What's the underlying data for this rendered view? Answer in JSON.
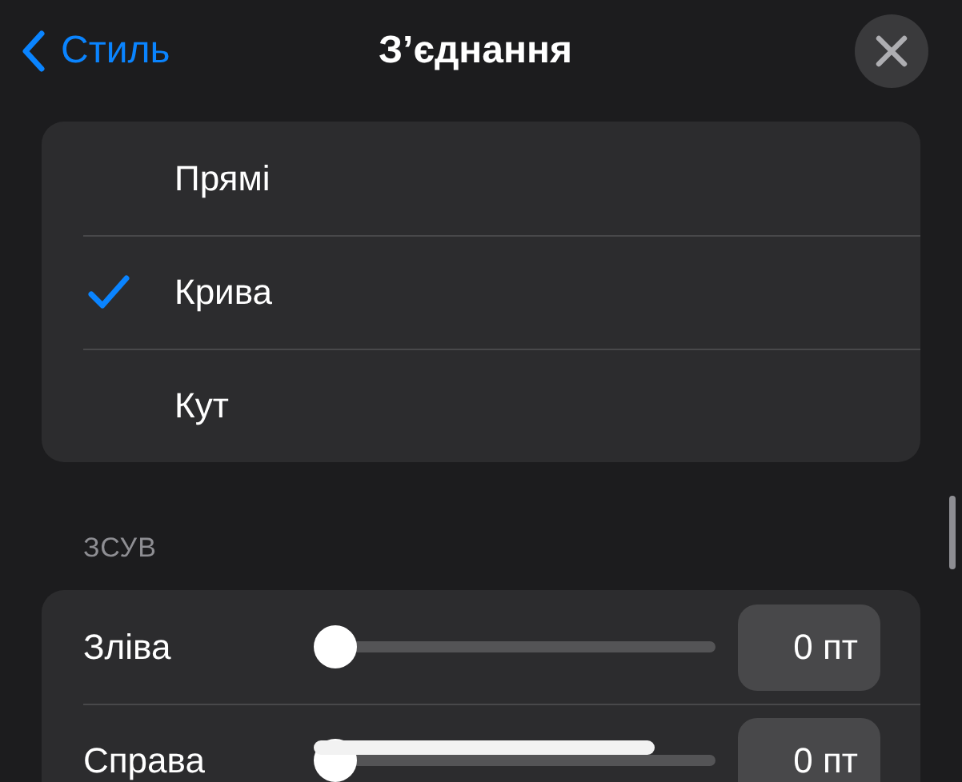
{
  "nav": {
    "back": "Стиль",
    "title": "З’єднання"
  },
  "options": [
    {
      "label": "Прямі",
      "selected": false
    },
    {
      "label": "Крива",
      "selected": true
    },
    {
      "label": "Кут",
      "selected": false
    }
  ],
  "offset": {
    "heading": "ЗСУВ",
    "rows": [
      {
        "label": "Зліва",
        "level": 0,
        "value": "0 пт"
      },
      {
        "label": "Справа",
        "level": 0,
        "value": "0 пт"
      }
    ]
  }
}
